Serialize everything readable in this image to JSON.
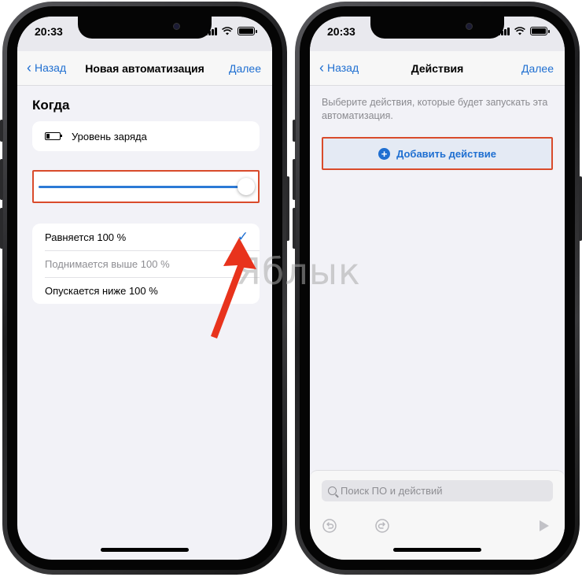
{
  "status_bar": {
    "time": "20:33"
  },
  "left_screen": {
    "nav": {
      "back_label": "Назад",
      "title": "Новая автоматизация",
      "next_label": "Далее"
    },
    "section_title": "Когда",
    "trigger_label": "Уровень заряда",
    "slider": {
      "value_percent": 100
    },
    "options": [
      {
        "label": "Равняется 100 %",
        "selected": true
      },
      {
        "label": "Поднимается выше 100 %",
        "selected": false
      },
      {
        "label": "Опускается ниже 100 %",
        "selected": false
      }
    ],
    "check_glyph": "✓"
  },
  "right_screen": {
    "nav": {
      "back_label": "Назад",
      "title": "Действия",
      "next_label": "Далее"
    },
    "hint": "Выберите действия, которые будет запускать эта автоматизация.",
    "add_action_label": "Добавить действие",
    "search": {
      "placeholder": "Поиск ПО и действий",
      "value": ""
    }
  },
  "watermark": "Яблык",
  "colors": {
    "accent": "#1f6fd1",
    "highlight_border": "#d94b2b",
    "arrow": "#e8331c"
  }
}
